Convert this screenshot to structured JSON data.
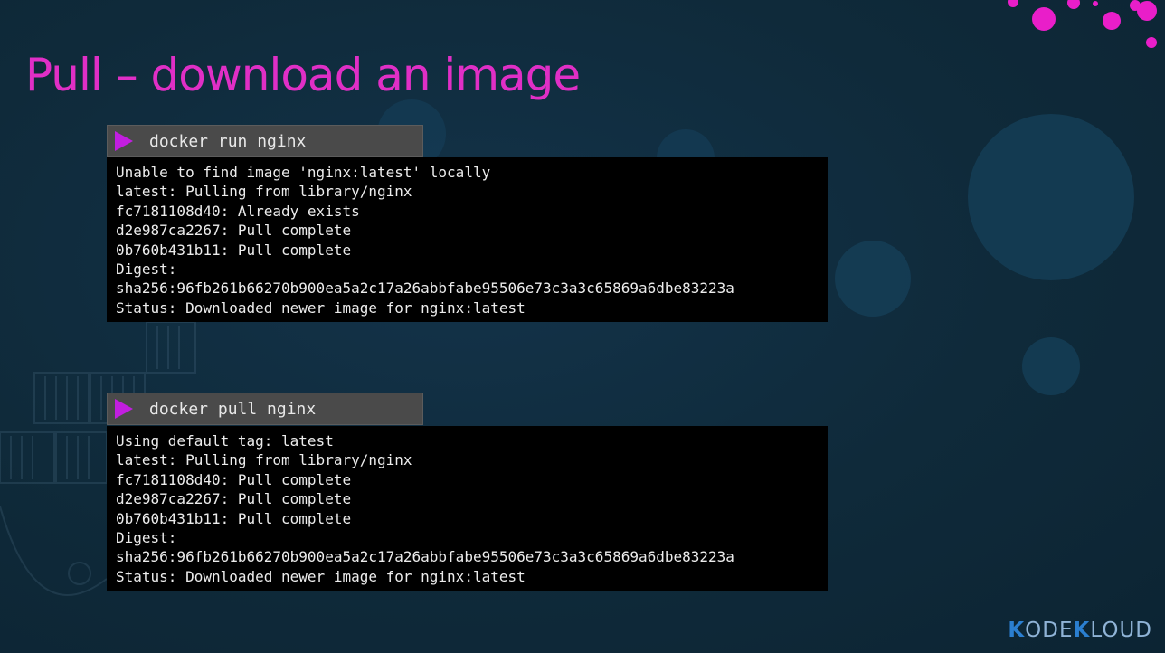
{
  "slide": {
    "title": "Pull – download an image"
  },
  "commands": [
    {
      "prompt_icon": "play-triangle-icon",
      "command": "docker run nginx",
      "output": [
        "Unable to find image 'nginx:latest' locally",
        "latest: Pulling from library/nginx",
        "fc7181108d40: Already exists",
        "d2e987ca2267: Pull complete",
        "0b760b431b11: Pull complete",
        "Digest:",
        "sha256:96fb261b66270b900ea5a2c17a26abbfabe95506e73c3a3c65869a6dbe83223a",
        "Status: Downloaded newer image for nginx:latest"
      ]
    },
    {
      "prompt_icon": "play-triangle-icon",
      "command": "docker pull nginx",
      "output": [
        "Using default tag: latest",
        "latest: Pulling from library/nginx",
        "fc7181108d40: Pull complete",
        "d2e987ca2267: Pull complete",
        "0b760b431b11: Pull complete",
        "Digest:",
        "sha256:96fb261b66270b900ea5a2c17a26abbfabe95506e73c3a3c65869a6dbe83223a",
        "Status: Downloaded newer image for nginx:latest"
      ]
    }
  ],
  "logo": {
    "text_k1": "K",
    "text_ode": "ODE",
    "text_k2": "K",
    "text_loud": "LOUD"
  },
  "colors": {
    "background": "#0f2a3a",
    "title": "#e02fc6",
    "prompt_icon": "#c21ee0",
    "command_bar": "#4a4a4a",
    "terminal_bg": "#000000",
    "terminal_text": "#ececec"
  }
}
